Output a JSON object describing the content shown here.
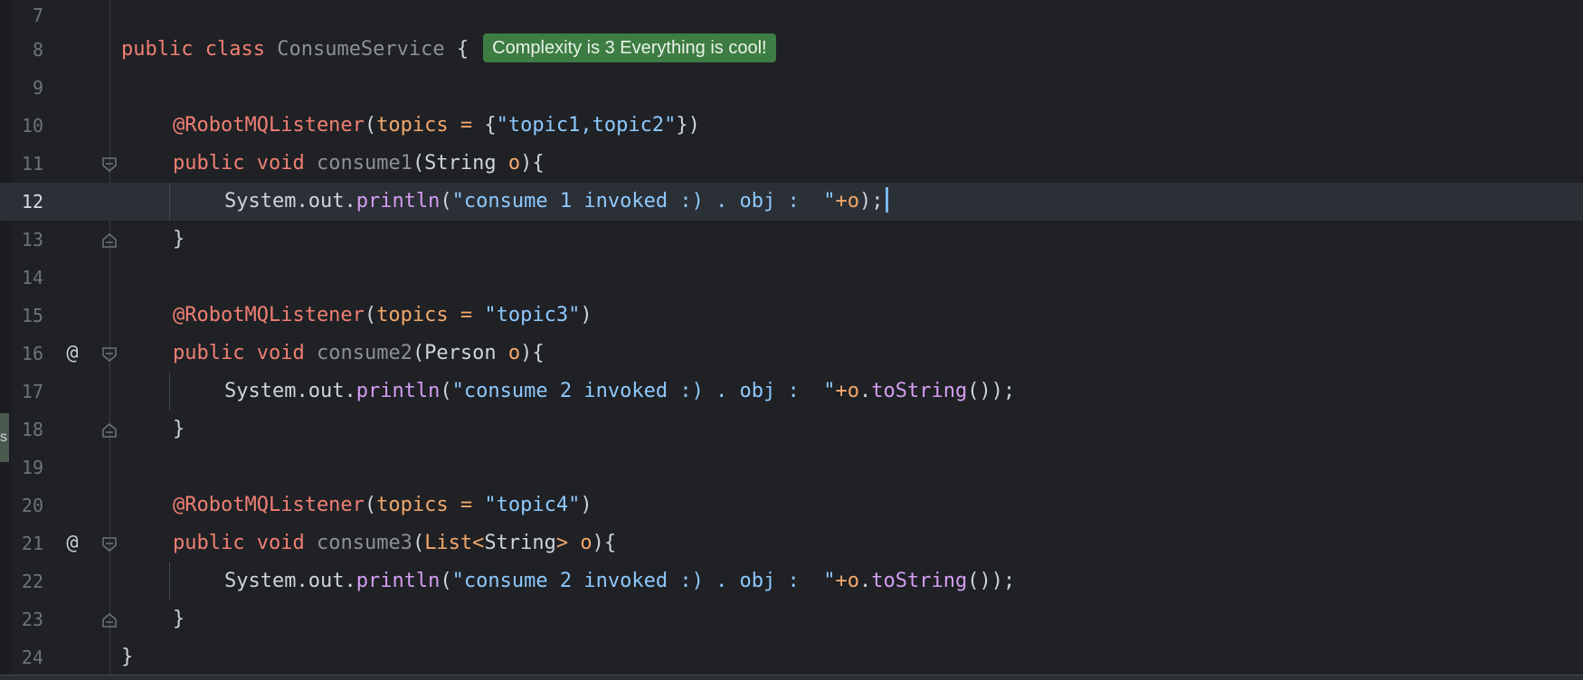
{
  "editor": {
    "line_numbers": [
      "7",
      "8",
      "9",
      "10",
      "11",
      "12",
      "13",
      "14",
      "15",
      "16",
      "17",
      "18",
      "19",
      "20",
      "21",
      "22",
      "23",
      "24"
    ],
    "current_line": "12",
    "left_marker_text": "s",
    "gutter_icons": {
      "line16": "@",
      "line21": "@"
    },
    "complexity_badge": "Complexity is 3 Everything is cool!",
    "code": {
      "l8_public": "public",
      "l8_class": "class",
      "l8_name": "ConsumeService",
      "l8_brace": "{",
      "l10_ann": "@RobotMQListener",
      "l10_open": "(",
      "l10_topics": "topics",
      "l10_eq": " = ",
      "l10_obrace": "{",
      "l10_str": "\"topic1,topic2\"",
      "l10_close": "})",
      "l11_public": "public",
      "l11_void": "void",
      "l11_method": "consume1",
      "l11_open": "(String ",
      "l11_param": "o",
      "l11_close": "){",
      "l12_sys": "System.out.",
      "l12_method": "println",
      "l12_open": "(",
      "l12_str": "\"consume 1 invoked :) . obj :  \"",
      "l12_plus": "+",
      "l12_o": "o",
      "l12_close": ");",
      "l13_brace": "}",
      "l15_ann": "@RobotMQListener",
      "l15_open": "(",
      "l15_topics": "topics",
      "l15_eq": " = ",
      "l15_str": "\"topic3\"",
      "l15_close": ")",
      "l16_public": "public",
      "l16_void": "void",
      "l16_method": "consume2",
      "l16_open": "(Person ",
      "l16_param": "o",
      "l16_close": "){",
      "l17_sys": "System.out.",
      "l17_method": "println",
      "l17_open": "(",
      "l17_str": "\"consume 2 invoked :) . obj :  \"",
      "l17_plus": "+",
      "l17_o": "o",
      "l17_dot": ".",
      "l17_tostring": "toString",
      "l17_close": "());",
      "l18_brace": "}",
      "l20_ann": "@RobotMQListener",
      "l20_open": "(",
      "l20_topics": "topics",
      "l20_eq": " = ",
      "l20_str": "\"topic4\"",
      "l20_close": ")",
      "l21_public": "public",
      "l21_void": "void",
      "l21_method": "consume3",
      "l21_open": "(",
      "l21_list": "List",
      "l21_lt": "<",
      "l21_string": "String",
      "l21_gt": "> ",
      "l21_param": "o",
      "l21_close": "){",
      "l22_sys": "System.out.",
      "l22_method": "println",
      "l22_open": "(",
      "l22_str": "\"consume 2 invoked :) . obj :  \"",
      "l22_plus": "+",
      "l22_o": "o",
      "l22_dot": ".",
      "l22_tostring": "toString",
      "l22_close": "());",
      "l23_brace": "}",
      "l24_brace": "}"
    }
  }
}
